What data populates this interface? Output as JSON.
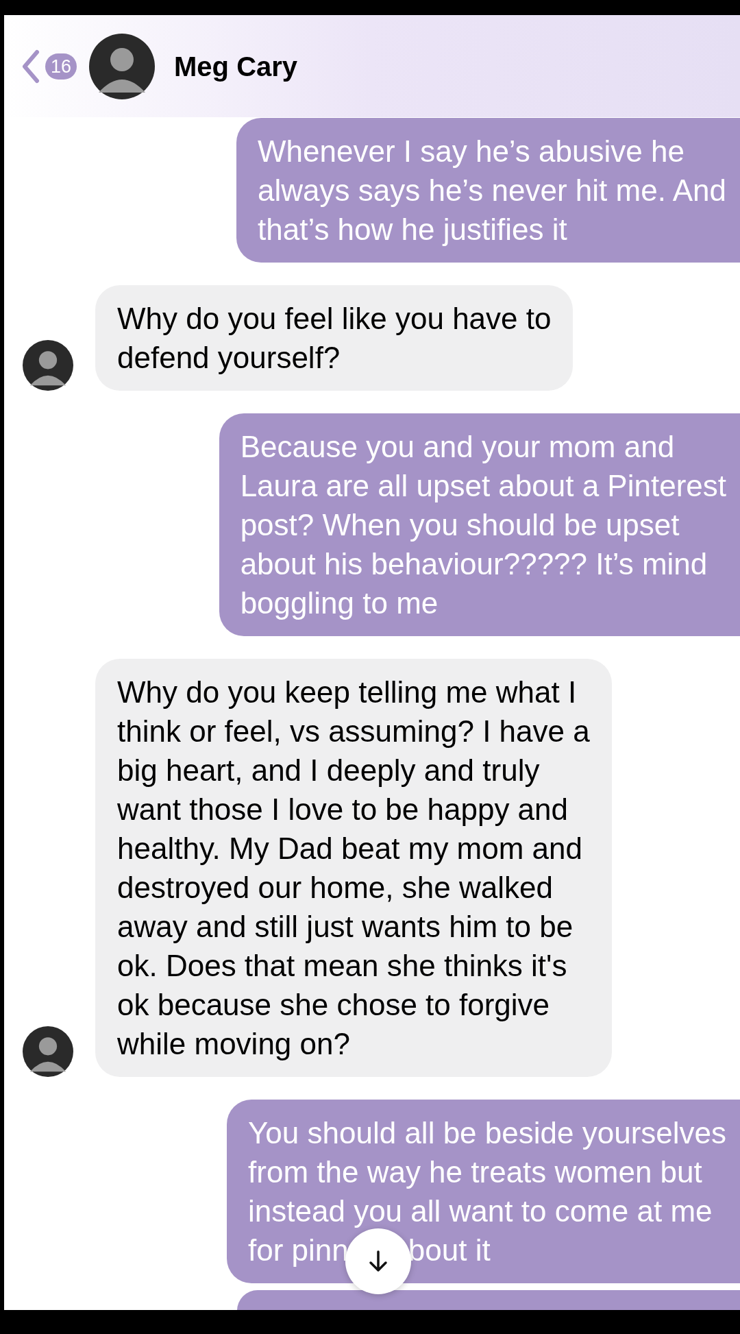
{
  "header": {
    "back_badge": "16",
    "contact_name": "Meg Cary"
  },
  "messages": [
    {
      "kind": "sent",
      "lines": [
        "Whenever I say he’s abusive he",
        "always says he’s never hit me. And",
        "that’s how he justifies it"
      ]
    },
    {
      "kind": "received",
      "lines": [
        "Why do you feel like you have to",
        "defend yourself?"
      ]
    },
    {
      "kind": "sent",
      "lines": [
        "Because you and your mom and",
        "Laura are all upset about a Pinterest",
        "post? When you should be upset",
        "about his behaviour????? It’s mind",
        "boggling to me"
      ]
    },
    {
      "kind": "received",
      "lines": [
        "Why do you keep telling me what I",
        "think or feel, vs assuming? I have a",
        "big heart, and I deeply and truly",
        "want those I love to be happy and",
        "healthy. My Dad beat my mom and",
        "destroyed our home, she walked",
        "away and still just wants him to be",
        "ok. Does that mean she thinks it's",
        "ok because she chose to forgive",
        "while moving on?"
      ]
    },
    {
      "kind": "sent",
      "lines": [
        "You should all be beside yourselves",
        "from the way he treats women but",
        "instead you all want to come at me",
        "for pinn"
      ],
      "after_button": "bout it"
    },
    {
      "kind": "sent_cut"
    }
  ],
  "scroll_down_button": true
}
